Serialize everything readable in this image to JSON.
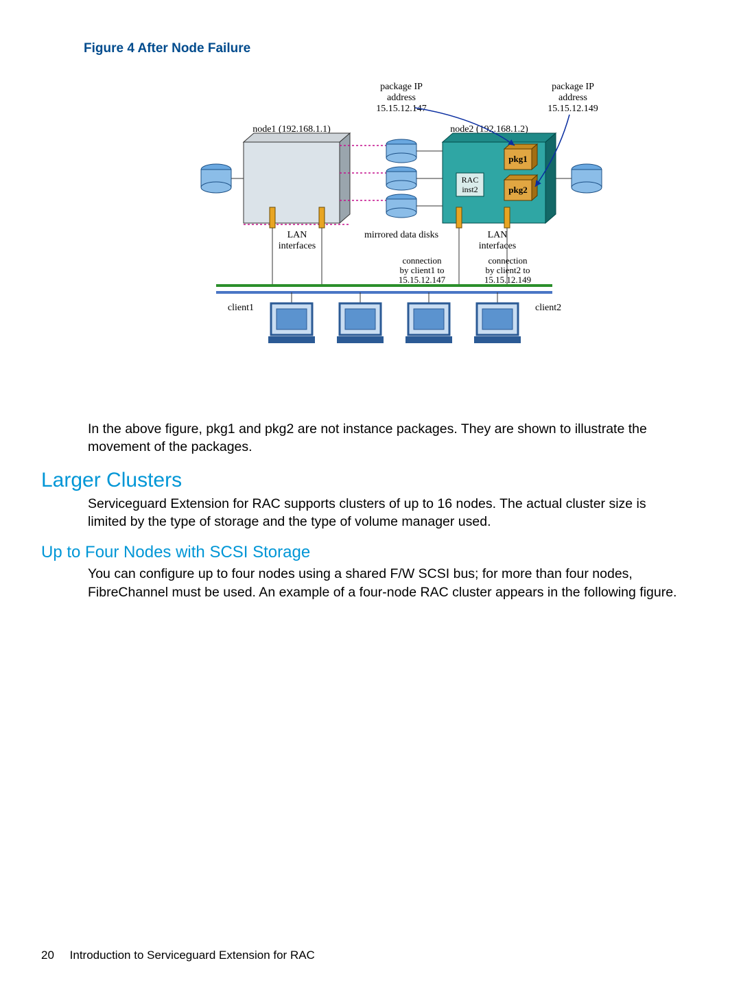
{
  "figure": {
    "caption": "Figure 4 After Node Failure"
  },
  "diagram": {
    "pkgip1": {
      "l1": "package IP",
      "l2": "address",
      "l3": "15.15.12.147"
    },
    "pkgip2": {
      "l1": "package IP",
      "l2": "address",
      "l3": "15.15.12.149"
    },
    "node1": "node1 (192.168.1.1)",
    "node2": "node2 (192.168.1.2)",
    "pkg1": "pkg1",
    "pkg2": "pkg2",
    "rac1": "RAC",
    "rac2": "inst2",
    "lan1a": "LAN",
    "lan1b": "interfaces",
    "mirror": "mirrored data disks",
    "lan2a": "LAN",
    "lan2b": "interfaces",
    "conn1a": "connection",
    "conn1b": "by client1 to",
    "conn1c": "15.15.12.147",
    "conn2a": "connection",
    "conn2b": "by client2 to",
    "conn2c": "15.15.12.149",
    "client1": "client1",
    "client2": "client2"
  },
  "para1": "In the above figure, pkg1 and pkg2 are not instance packages. They are shown to illustrate the movement of the packages.",
  "heading2": "Larger Clusters",
  "para2": "Serviceguard Extension for RAC supports clusters of up to 16 nodes. The actual cluster size is limited by the type of storage and the type of volume manager used.",
  "heading3": "Up to Four Nodes with SCSI Storage",
  "para3": "You can configure up to four nodes using a shared F/W SCSI bus; for more than four nodes, FibreChannel must be used. An example of a four-node RAC cluster appears in the following figure.",
  "footer": {
    "page": "20",
    "title": "Introduction to Serviceguard Extension for RAC"
  }
}
